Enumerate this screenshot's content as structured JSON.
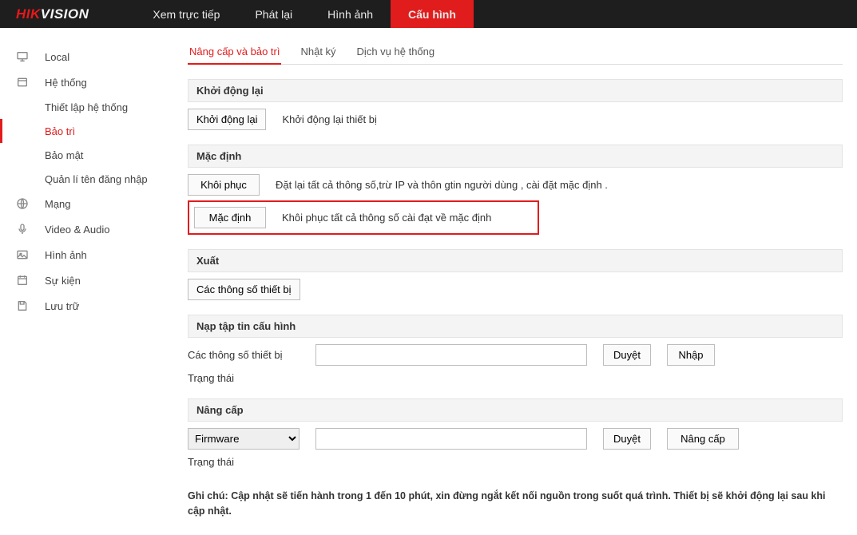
{
  "brand": {
    "hik": "HIK",
    "vision": "VISION"
  },
  "topnav": {
    "tabs": [
      {
        "label": "Xem trực tiếp"
      },
      {
        "label": "Phát lại"
      },
      {
        "label": "Hình ảnh"
      },
      {
        "label": "Cấu hình",
        "active": true
      }
    ]
  },
  "sidebar": {
    "items": [
      {
        "label": "Local",
        "icon": "monitor"
      },
      {
        "label": "Hệ thống",
        "icon": "device"
      },
      {
        "label": "Thiết lập hệ thống",
        "sub": true
      },
      {
        "label": "Bảo trì",
        "sub": true,
        "active": true
      },
      {
        "label": "Bảo mật",
        "sub": true
      },
      {
        "label": "Quản lí tên đăng nhập",
        "sub": true
      },
      {
        "label": "Mạng",
        "icon": "globe"
      },
      {
        "label": "Video & Audio",
        "icon": "mic"
      },
      {
        "label": "Hình ảnh",
        "icon": "image"
      },
      {
        "label": "Sự kiện",
        "icon": "calendar"
      },
      {
        "label": "Lưu trữ",
        "icon": "storage"
      }
    ]
  },
  "subtabs": [
    {
      "label": "Nâng cấp và bảo trì",
      "active": true
    },
    {
      "label": "Nhật ký"
    },
    {
      "label": "Dịch vụ hệ thống"
    }
  ],
  "sections": {
    "reboot": {
      "header": "Khởi động lại",
      "button": "Khởi động lại",
      "desc": "Khởi động lại thiết bị"
    },
    "default": {
      "header": "Mặc định",
      "restore_btn": "Khôi phục",
      "restore_desc": "Đặt lại tất cả thông số,trừ IP và thôn gtin người dùng , cài đặt mặc định .",
      "default_btn": "Mặc định",
      "default_desc": "Khôi phục tất cả thông số cài đạt về mặc định"
    },
    "export": {
      "header": "Xuất",
      "button": "Các thông số thiết bị"
    },
    "import": {
      "header": "Nạp tập tin cấu hình",
      "label": "Các thông số thiết bị",
      "browse": "Duyệt",
      "import_btn": "Nhập",
      "status_label": "Trạng thái"
    },
    "upgrade": {
      "header": "Nâng cấp",
      "select_value": "Firmware",
      "browse": "Duyệt",
      "upgrade_btn": "Nâng cấp",
      "status_label": "Trạng thái"
    },
    "note_prefix": "Ghi chú:",
    "note_body": "Cập nhật sẽ tiến hành trong 1 đến 10 phút, xin đừng ngắt kết nối nguồn trong suốt quá trình. Thiết bị sẽ khởi động lại sau khi cập nhật."
  }
}
